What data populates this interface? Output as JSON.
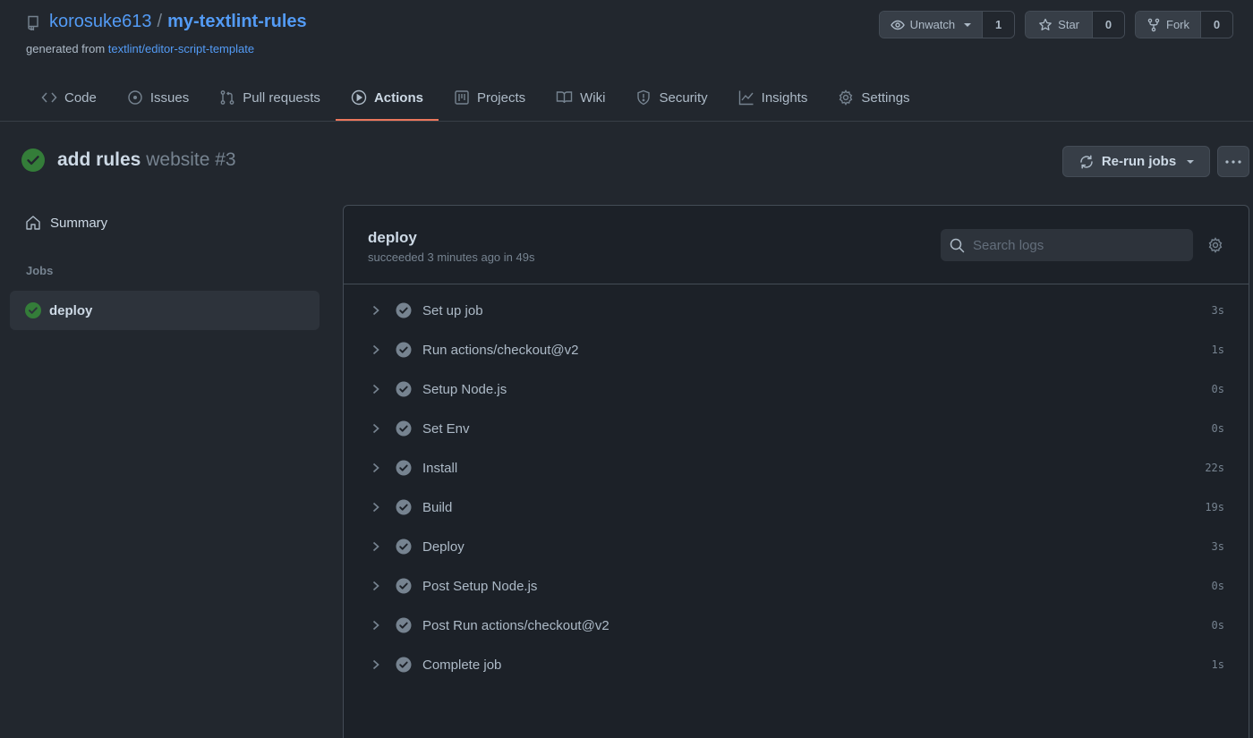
{
  "repo": {
    "owner": "korosuke613",
    "separator": "/",
    "name": "my-textlint-rules",
    "generated_prefix": "generated from",
    "template": "textlint/editor-script-template"
  },
  "repo_actions": {
    "watch_label": "Unwatch",
    "watch_count": "1",
    "star_label": "Star",
    "star_count": "0",
    "fork_label": "Fork",
    "fork_count": "0"
  },
  "tabs": [
    {
      "label": "Code",
      "icon": "code-icon"
    },
    {
      "label": "Issues",
      "icon": "issue-icon"
    },
    {
      "label": "Pull requests",
      "icon": "pull-request-icon"
    },
    {
      "label": "Actions",
      "icon": "play-icon",
      "active": true
    },
    {
      "label": "Projects",
      "icon": "project-icon"
    },
    {
      "label": "Wiki",
      "icon": "book-icon"
    },
    {
      "label": "Security",
      "icon": "shield-icon"
    },
    {
      "label": "Insights",
      "icon": "graph-icon"
    },
    {
      "label": "Settings",
      "icon": "gear-icon"
    }
  ],
  "run": {
    "title": "add rules",
    "workflow_and_number": "website #3",
    "status": "success",
    "rerun_label": "Re-run jobs"
  },
  "sidebar": {
    "summary_label": "Summary",
    "jobs_label": "Jobs",
    "jobs": [
      {
        "name": "deploy",
        "status": "success"
      }
    ]
  },
  "job": {
    "name": "deploy",
    "meta": "succeeded 3 minutes ago in 49s",
    "search_placeholder": "Search logs",
    "steps": [
      {
        "name": "Set up job",
        "time": "3s"
      },
      {
        "name": "Run actions/checkout@v2",
        "time": "1s"
      },
      {
        "name": "Setup Node.js",
        "time": "0s"
      },
      {
        "name": "Set Env",
        "time": "0s"
      },
      {
        "name": "Install",
        "time": "22s"
      },
      {
        "name": "Build",
        "time": "19s"
      },
      {
        "name": "Deploy",
        "time": "3s"
      },
      {
        "name": "Post Setup Node.js",
        "time": "0s"
      },
      {
        "name": "Post Run actions/checkout@v2",
        "time": "0s"
      },
      {
        "name": "Complete job",
        "time": "1s"
      }
    ]
  },
  "colors": {
    "background": "#22272e",
    "link": "#539bf5",
    "success": "#347d39",
    "active_tab_underline": "#ec775c",
    "step_check": "#768390"
  }
}
